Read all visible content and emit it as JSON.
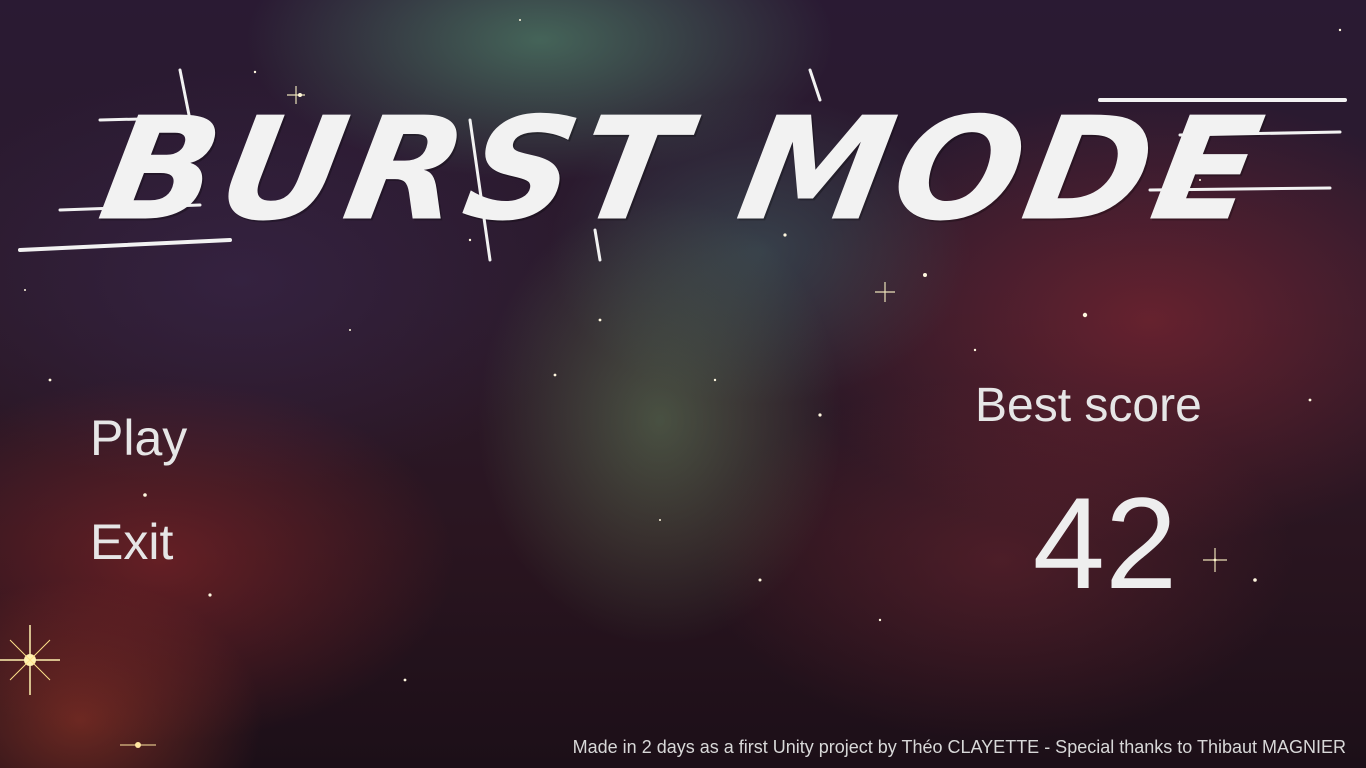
{
  "game": {
    "title": "BURST MODE"
  },
  "menu": {
    "play_label": "Play",
    "exit_label": "Exit"
  },
  "score": {
    "label": "Best score",
    "value": "42"
  },
  "footer": {
    "credits": "Made in 2 days as a first Unity project by Théo CLAYETTE - Special thanks to Thibaut MAGNIER"
  },
  "colors": {
    "text": "#e6e6e6",
    "title": "#f2f2f2"
  }
}
